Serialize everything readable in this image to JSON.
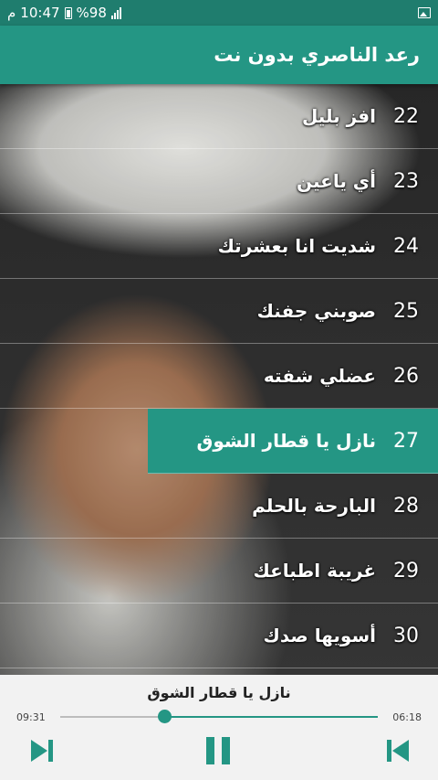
{
  "status_bar": {
    "time": "10:47",
    "battery": "%98",
    "carrier_glyph": "م"
  },
  "app_bar": {
    "title": "رعد الناصري بدون نت"
  },
  "tracks": [
    {
      "num": "22",
      "title": "افز بليل"
    },
    {
      "num": "23",
      "title": "أي ياعين"
    },
    {
      "num": "24",
      "title": "شديت انا بعشرتك"
    },
    {
      "num": "25",
      "title": "صوبني جفنك"
    },
    {
      "num": "26",
      "title": "عضلي شفته"
    },
    {
      "num": "27",
      "title": "نازل يا قطار الشوق"
    },
    {
      "num": "28",
      "title": "البارحة بالحلم"
    },
    {
      "num": "29",
      "title": "غريبة اطباعك"
    },
    {
      "num": "30",
      "title": "أسويها صدك"
    }
  ],
  "player": {
    "now_playing": "نازل يا قطار الشوق",
    "elapsed": "09:31",
    "duration": "06:18",
    "progress_fraction": 0.67
  },
  "colors": {
    "accent": "#249684",
    "status_bar": "#1f7d6e",
    "player_bg": "#f2f2f2"
  }
}
